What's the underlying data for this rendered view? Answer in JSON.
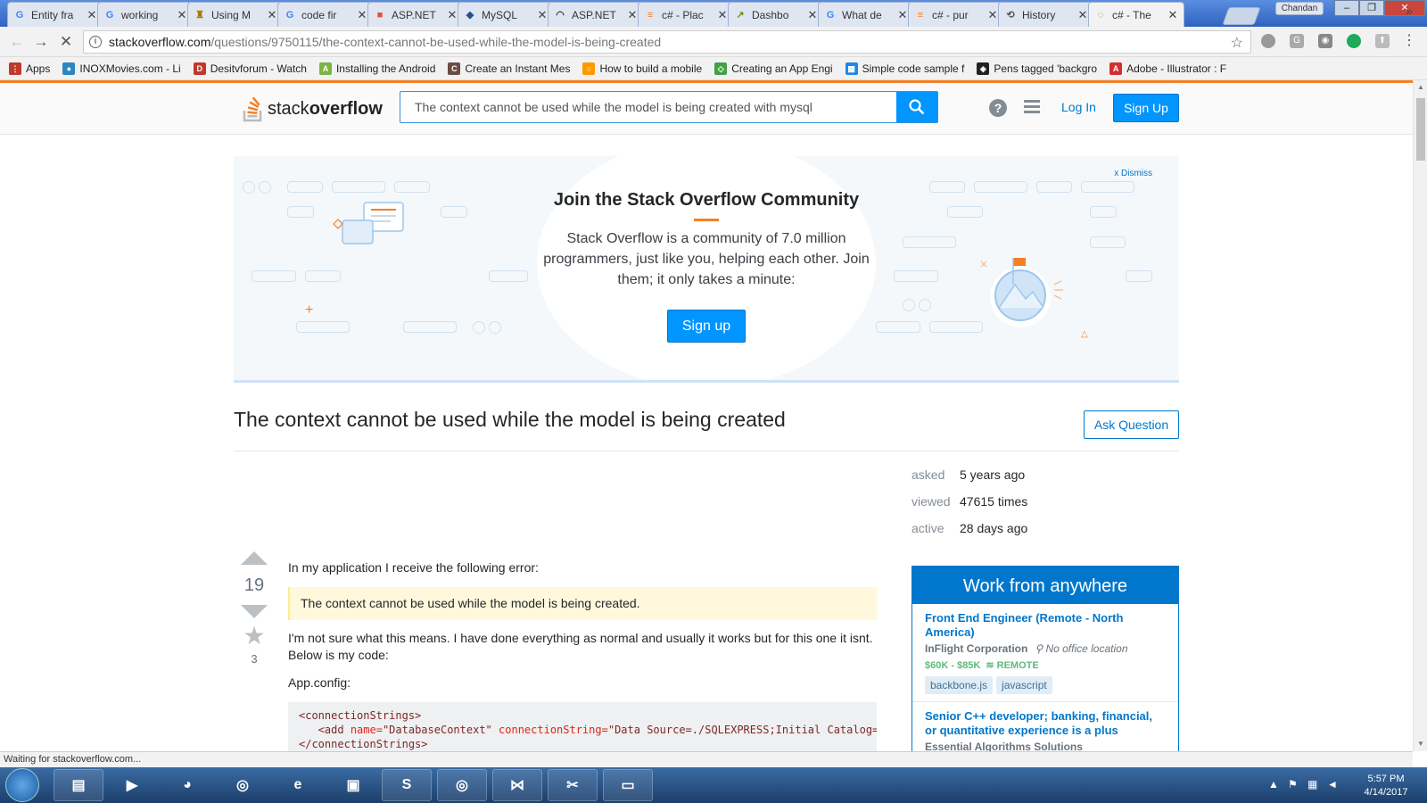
{
  "browser": {
    "tabs": [
      {
        "title": "Entity fra",
        "fav": "G",
        "color": "#4285f4"
      },
      {
        "title": "working",
        "fav": "G",
        "color": "#4285f4"
      },
      {
        "title": "Using M",
        "fav": "♜",
        "color": "#a67c00"
      },
      {
        "title": "code fir",
        "fav": "G",
        "color": "#4285f4"
      },
      {
        "title": "ASP.NET",
        "fav": "■",
        "color": "#e74c3c"
      },
      {
        "title": "MySQL",
        "fav": "◆",
        "color": "#2a4d8f"
      },
      {
        "title": "ASP.NET",
        "fav": "◠",
        "color": "#333"
      },
      {
        "title": "c# - Plac",
        "fav": "≡",
        "color": "#f48024"
      },
      {
        "title": "Dashbo",
        "fav": "↗",
        "color": "#6b8e23"
      },
      {
        "title": "What de",
        "fav": "G",
        "color": "#4285f4"
      },
      {
        "title": "c# - pur",
        "fav": "≡",
        "color": "#f48024"
      },
      {
        "title": "History",
        "fav": "⟲",
        "color": "#555"
      },
      {
        "title": "c# - The",
        "fav": "◌",
        "color": "#777"
      }
    ],
    "profile": "Chandan",
    "url_host": "stackoverflow.com",
    "url_path": "/questions/9750115/the-context-cannot-be-used-while-the-model-is-being-created",
    "bookmarks": [
      {
        "label": "Apps",
        "color": "#c0392b",
        "glyph": "⋮"
      },
      {
        "label": "INOXMovies.com - Li",
        "color": "#2e86c1",
        "glyph": "●"
      },
      {
        "label": "Desitvforum - Watch",
        "color": "#c0392b",
        "glyph": "D"
      },
      {
        "label": "Installing the Android",
        "color": "#7cb342",
        "glyph": "A"
      },
      {
        "label": "Create an Instant Mes",
        "color": "#6d4c41",
        "glyph": "C"
      },
      {
        "label": "How to build a mobile",
        "color": "#ff9800",
        "glyph": "○"
      },
      {
        "label": "Creating an App Engi",
        "color": "#43a047",
        "glyph": "◇"
      },
      {
        "label": "Simple code sample f",
        "color": "#1e88e5",
        "glyph": "▦"
      },
      {
        "label": "Pens tagged 'backgro",
        "color": "#222",
        "glyph": "◈"
      },
      {
        "label": "Adobe - Illustrator : F",
        "color": "#d32f2f",
        "glyph": "A"
      }
    ],
    "status_text": "Waiting for stackoverflow.com..."
  },
  "header": {
    "logo_light": "stack",
    "logo_bold": "overflow",
    "search_value": "The context cannot be used while the model is being created with mysql",
    "login": "Log In",
    "signup": "Sign Up"
  },
  "banner": {
    "dismiss": "x Dismiss",
    "title": "Join the Stack Overflow Community",
    "text": "Stack Overflow is a community of 7.0 million programmers, just like you, helping each other. Join them; it only takes a minute:",
    "button": "Sign up"
  },
  "question": {
    "title": "The context cannot be used while the model is being created",
    "ask_button": "Ask Question",
    "stats": [
      {
        "label": "asked",
        "value": "5 years ago"
      },
      {
        "label": "viewed",
        "value": "47615 times"
      },
      {
        "label": "active",
        "value": "28 days ago"
      }
    ],
    "votes": "19",
    "favorites": "3",
    "body_intro": "In my application I receive the following error:",
    "quote": "The context cannot be used while the model is being created.",
    "body_2": "I'm not sure what this means. I have done everything as normal and usually it works but for this one it isnt. Below is my code:",
    "body_3": "App.config:",
    "code_line1": "<connectionStrings>",
    "code_line2_tag": "<add",
    "code_line2_attr1": "name=",
    "code_line2_val1": "\"DatabaseContext\"",
    "code_line2_attr2": "connectionString=",
    "code_line2_val2": "\"Data Source=./SQLEXPRESS;Initial Catalog=F",
    "code_line3": "</connectionStrings>"
  },
  "jobs": {
    "heading": "Work from anywhere",
    "items": [
      {
        "title": "Front End Engineer (Remote - North America)",
        "company": "InFlight Corporation",
        "location": "No office location",
        "salary": "$60K - $85K",
        "remote": "REMOTE",
        "tags": [
          "backbone.js",
          "javascript"
        ]
      },
      {
        "title": "Senior C++ developer; banking, financial, or quantitative experience is a plus",
        "company": "Essential Algorithms Solutions"
      }
    ]
  },
  "taskbar": {
    "time": "5:57 PM",
    "date": "4/14/2017"
  }
}
